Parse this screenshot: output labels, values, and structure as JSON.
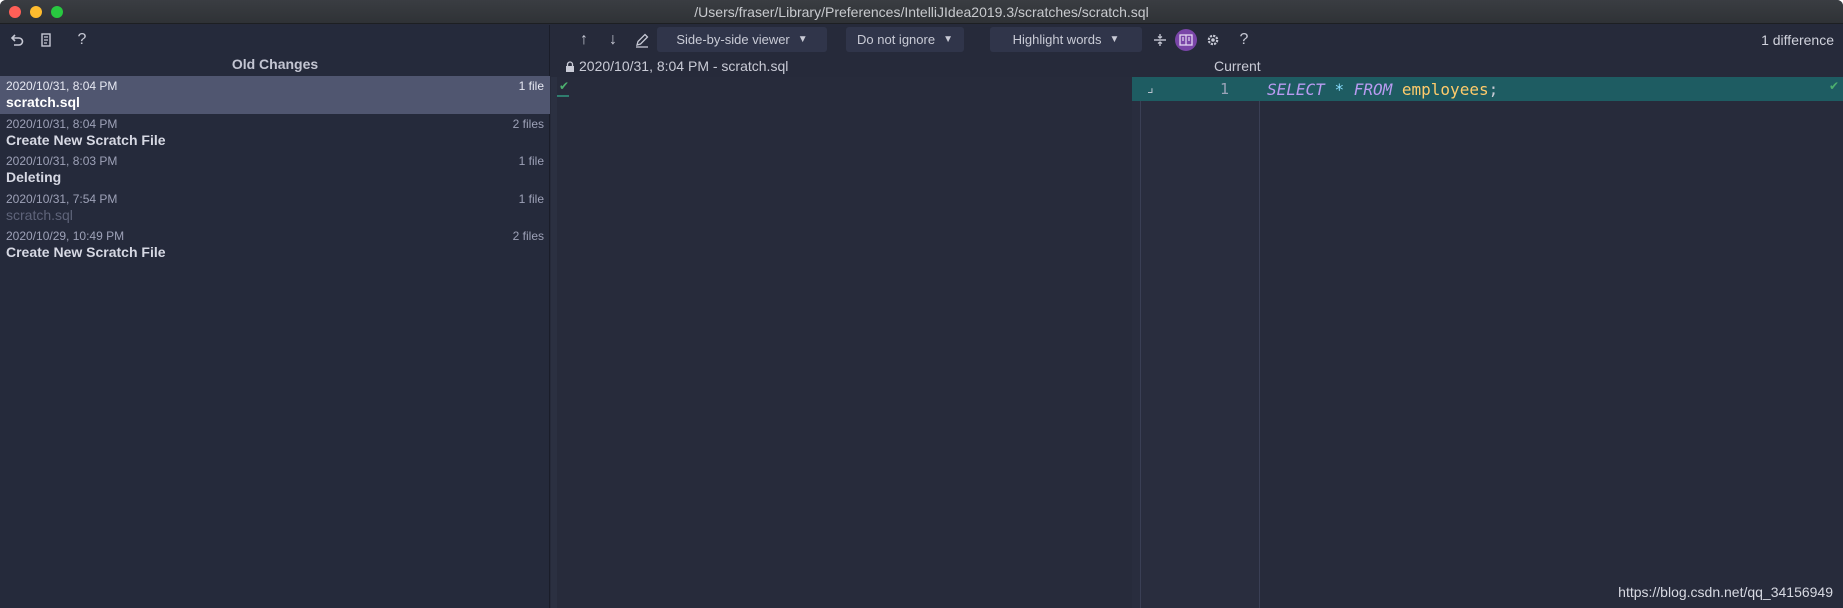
{
  "window": {
    "title": "/Users/fraser/Library/Preferences/IntelliJIdea2019.3/scratches/scratch.sql"
  },
  "left_toolbar": {
    "revert_icon": "undo-icon",
    "patch_icon": "create-patch-icon",
    "help_label": "?"
  },
  "left_panel": {
    "header": "Old Changes",
    "items": [
      {
        "date": "2020/10/31, 8:04 PM",
        "count": "1 file",
        "label": "scratch.sql",
        "selected": true
      },
      {
        "date": "2020/10/31, 8:04 PM",
        "count": "2 files",
        "label": "Create New Scratch File"
      },
      {
        "date": "2020/10/31, 8:03 PM",
        "count": "1 file",
        "label": "Deleting"
      },
      {
        "date": "2020/10/31, 7:54 PM",
        "count": "1 file",
        "label": "scratch.sql",
        "dim": true
      },
      {
        "date": "2020/10/29, 10:49 PM",
        "count": "2 files",
        "label": "Create New Scratch File"
      }
    ]
  },
  "diff_toolbar": {
    "prev_label": "↑",
    "next_label": "↓",
    "viewer_label": "Side-by-side viewer",
    "ignore_label": "Do not ignore",
    "highlight_label": "Highlight words",
    "help_label": "?",
    "difference_count": "1 difference"
  },
  "diff": {
    "left_header": "2020/10/31, 8:04 PM - scratch.sql",
    "right_header": "Current",
    "line_number": "1",
    "code": {
      "kw1": "SELECT",
      "op": "*",
      "kw2": "FROM",
      "table": "employees",
      "semi": ";"
    }
  },
  "watermark": "https://blog.csdn.net/qq_34156949",
  "colors": {
    "background": "#262a3a",
    "selected_row": "#505670",
    "changed_line": "#1e5c62",
    "keyword": "#b99bf1",
    "identifier": "#ffcb6b",
    "ok_check": "#4caf6e"
  }
}
